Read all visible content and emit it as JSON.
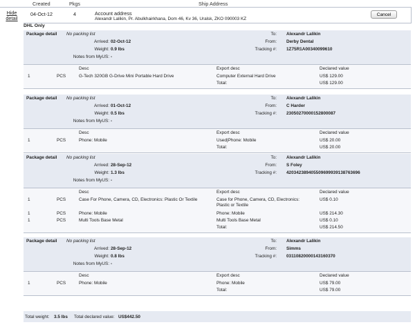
{
  "header": {
    "created": "Created",
    "pkgs": "Pkgs",
    "ship_address": "Ship Address"
  },
  "shipment": {
    "hide_detail": "Hide detail",
    "created": "04-Oct-12",
    "pkgs": "4",
    "address_title": "Account address",
    "address_line": "Alexandr Lalikin, Pr. Abulkhairkhana, Dom 46, Kv 36, Uralsk, ZKO 090003 KZ",
    "cancel_label": "Cancel"
  },
  "carrier": "DHL Only",
  "labels": {
    "package_detail": "Package detail",
    "no_packing": "No packing list",
    "arrived": "Arrived:",
    "weight": "Weight:",
    "notes": "Notes from MyUS:",
    "to": "To:",
    "from": "From:",
    "tracking": "Tracking #:",
    "desc": "Desc",
    "export_desc": "Export desc",
    "declared": "Declared value",
    "total": "Total:"
  },
  "packages": [
    {
      "arrived": "02-Oct-12",
      "weight": "0.9 lbs",
      "notes": "-",
      "to": "Alexandr Lalikin",
      "from": "Derby Dental",
      "tracking": "1Z75R1A00340099610",
      "items": [
        {
          "qty": "1",
          "unit": "PCS",
          "desc": "G-Tech 320GB G-Drive Mini Portable Hard Drive",
          "export": "Computer External Hard Drive",
          "value": "US$ 129.00"
        }
      ],
      "total": "US$ 129.00"
    },
    {
      "arrived": "01-Oct-12",
      "weight": "0.5 lbs",
      "notes": "-",
      "to": "Alexandr Lalikin",
      "from": "C Harder",
      "tracking": "23050270000152800087",
      "items": [
        {
          "qty": "1",
          "unit": "PCS",
          "desc": "Phone: Mobile",
          "export": "Used|Phone: Mobile",
          "value": "US$ 20.00"
        }
      ],
      "total": "US$ 20.00"
    },
    {
      "arrived": "28-Sep-12",
      "weight": "1.3 lbs",
      "notes": "-",
      "to": "Alexandr Lalikin",
      "from": "S Foley",
      "tracking": "420342389405509699939138763696",
      "items": [
        {
          "qty": "1",
          "unit": "PCS",
          "desc": "Case For Phone, Camera, CD, Electronics: Plastic Or Textile",
          "export": "Case for Phone, Camera, CD, Electronics: Plastic or Textile",
          "value": "US$ 0.10"
        },
        {
          "qty": "1",
          "unit": "PCS",
          "desc": "Phone: Mobile",
          "export": "Phone: Mobile",
          "value": "US$ 214.30"
        },
        {
          "qty": "1",
          "unit": "PCS",
          "desc": "Multi Tools Base Metal",
          "export": "Multi Tools Base Metal",
          "value": "US$ 0.10"
        }
      ],
      "total": "US$ 214.50"
    },
    {
      "arrived": "28-Sep-12",
      "weight": "0.8 lbs",
      "notes": "-",
      "to": "Alexandr Lalikin",
      "from": "Simms",
      "tracking": "03110820000143160370",
      "items": [
        {
          "qty": "1",
          "unit": "PCS",
          "desc": "Phone: Mobile",
          "export": "Phone: Mobile",
          "value": "US$ 79.00"
        }
      ],
      "total": "US$ 79.00"
    }
  ],
  "footer": {
    "weight_label": "Total weight:",
    "weight_value": "3.5 lbs",
    "value_label": "Total declared value:",
    "value_value": "US$442.50"
  }
}
